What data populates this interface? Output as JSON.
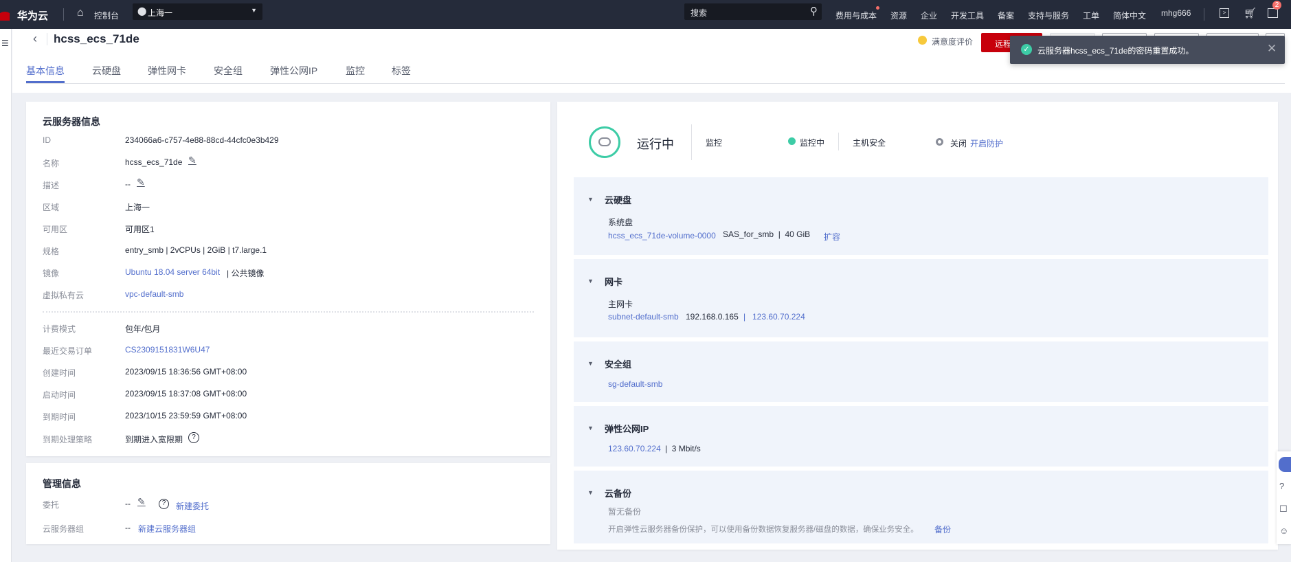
{
  "topbar": {
    "brand": "华为云",
    "console": "控制台",
    "region": "上海一",
    "search_placeholder": "搜索",
    "nav": [
      "费用与成本",
      "资源",
      "企业",
      "开发工具",
      "备案",
      "支持与服务",
      "工单",
      "简体中文",
      "mhg666"
    ],
    "message_badge": "2"
  },
  "header": {
    "title": "hcss_ecs_71de",
    "satisfaction": "满意度评价",
    "remote_login": "远程登录",
    "tabs": [
      "基本信息",
      "云硬盘",
      "弹性网卡",
      "安全组",
      "弹性公网IP",
      "监控",
      "标签"
    ]
  },
  "toast": {
    "message": "云服务器hcss_ecs_71de的密码重置成功。"
  },
  "server_info": {
    "title": "云服务器信息",
    "rows": [
      {
        "label": "ID",
        "value": "234066a6-c757-4e88-88cd-44cfc0e3b429"
      },
      {
        "label": "名称",
        "value": "hcss_ecs_71de"
      },
      {
        "label": "描述",
        "value": "--"
      },
      {
        "label": "区域",
        "value": "上海一"
      },
      {
        "label": "可用区",
        "value": "可用区1"
      },
      {
        "label": "规格",
        "value": "entry_smb | 2vCPUs | 2GiB | t7.large.1"
      },
      {
        "label": "镜像",
        "value": "Ubuntu 18.04 server 64bit",
        "extra": " | 公共镜像"
      },
      {
        "label": "虚拟私有云",
        "value": "vpc-default-smb"
      },
      {
        "label": "计费模式",
        "value": "包年/包月"
      },
      {
        "label": "最近交易订单",
        "value": "CS2309151831W6U47"
      },
      {
        "label": "创建时间",
        "value": "2023/09/15 18:36:56 GMT+08:00"
      },
      {
        "label": "启动时间",
        "value": "2023/09/15 18:37:08 GMT+08:00"
      },
      {
        "label": "到期时间",
        "value": "2023/10/15 23:59:59 GMT+08:00"
      },
      {
        "label": "到期处理策略",
        "value": "到期进入宽限期"
      }
    ]
  },
  "manage_info": {
    "title": "管理信息",
    "delegate_label": "委托",
    "delegate_value": "--",
    "delegate_link": "新建委托",
    "group_label": "云服务器组",
    "group_value": "--",
    "group_link": "新建云服务器组"
  },
  "status": {
    "state": "运行中",
    "monitor_label": "监控",
    "monitor_state": "监控中",
    "security_label": "主机安全",
    "security_state": "关闭",
    "security_link": "开启防护",
    "running_color": "#3dcca6"
  },
  "sections": {
    "disk": {
      "title": "云硬盘",
      "sub": "系统盘",
      "name": "hcss_ecs_71de-volume-0000",
      "info": "SAS_for_smb  |  40 GiB",
      "action": "扩容"
    },
    "nic": {
      "title": "网卡",
      "sub": "主网卡",
      "subnet": "subnet-default-smb",
      "ip": "192.168.0.165",
      "sep": "|",
      "eip": "123.60.70.224"
    },
    "sg": {
      "title": "安全组",
      "name": "sg-default-smb"
    },
    "eip": {
      "title": "弹性公网IP",
      "ip": "123.60.70.224",
      "bw": "|  3 Mbit/s"
    },
    "backup": {
      "title": "云备份",
      "none": "暂无备份",
      "desc": "开启弹性云服务器备份保护，可以使用备份数据恢复服务器/磁盘的数据，确保业务安全。",
      "action": "备份"
    }
  }
}
